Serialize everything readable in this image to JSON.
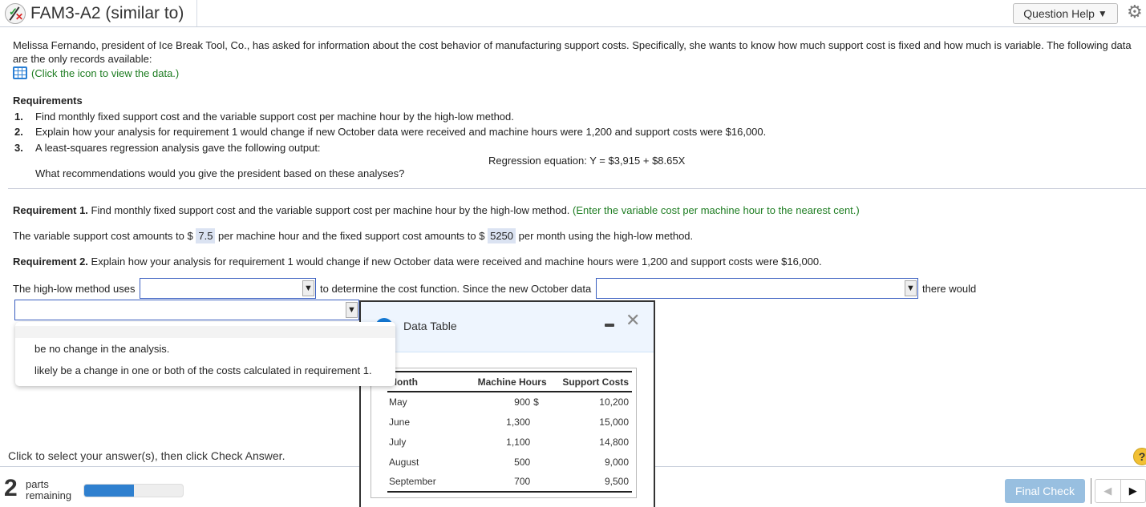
{
  "header": {
    "title": "FAM3-A2 (similar to)",
    "question_help": "Question Help",
    "status_icon": "partial-correct-icon",
    "settings_icon": "gear-icon"
  },
  "intro": {
    "text": "Melissa Fernando, president of Ice Break Tool, Co., has asked for information about the cost behavior of manufacturing support costs. Specifically, she wants to know how much support cost is fixed and how much is variable. The following data are the only records available:",
    "data_link": "(Click the icon to view the data.)"
  },
  "requirements": {
    "title": "Requirements",
    "items": [
      {
        "num": "1.",
        "text": "Find monthly fixed support cost and the variable support cost per machine hour by the high-low method."
      },
      {
        "num": "2.",
        "text": "Explain how your analysis for requirement 1 would change if new October data were received and machine hours were 1,200 and support costs were $16,000."
      },
      {
        "num": "3.",
        "text": "A least-squares regression analysis gave the following output:"
      }
    ],
    "regression": "Regression equation: Y = $3,915 + $8.65X",
    "recommend": "What recommendations would you give the president based on these analyses?"
  },
  "req1": {
    "label": "Requirement 1.",
    "text": " Find monthly fixed support cost and the variable support cost per machine hour by the high-low method. ",
    "hint": "(Enter the variable cost per machine hour to the nearest cent.)",
    "answer_pre": "The variable support cost amounts to $ ",
    "variable_cost": "7.5",
    "answer_mid": " per machine hour and the fixed support cost amounts to $ ",
    "fixed_cost": "5250",
    "answer_post": " per month using the high-low method."
  },
  "req2": {
    "label": "Requirement 2.",
    "text": " Explain how your analysis for requirement 1 would change if new October data were received and machine hours were 1,200 and support costs were $16,000.",
    "sentence_part1": "The high-low method uses",
    "sentence_part2": "to determine the cost function. Since the new October data",
    "sentence_part3": "there would",
    "select1_value": "",
    "select2_value": "",
    "select3_value": "",
    "dropdown_options": [
      "",
      "be no change in the analysis.",
      "likely be a change in one or both of the costs calculated in requirement 1."
    ]
  },
  "data_table": {
    "title": "Data Table",
    "columns": [
      "Month",
      "Machine Hours",
      "Support Costs"
    ],
    "rows": [
      {
        "month": "May",
        "hours": "900",
        "currency": "$",
        "cost": "10,200"
      },
      {
        "month": "June",
        "hours": "1,300",
        "currency": "",
        "cost": "15,000"
      },
      {
        "month": "July",
        "hours": "1,100",
        "currency": "",
        "cost": "14,800"
      },
      {
        "month": "August",
        "hours": "500",
        "currency": "",
        "cost": "9,000"
      },
      {
        "month": "September",
        "hours": "700",
        "currency": "",
        "cost": "9,500"
      }
    ]
  },
  "footer": {
    "instructions": "Click to select your answer(s), then click Check Answer.",
    "parts_count": "2",
    "parts_label_1": "parts",
    "parts_label_2": "remaining",
    "progress_percent": 50,
    "final_check": "Final Check",
    "help": "?"
  }
}
